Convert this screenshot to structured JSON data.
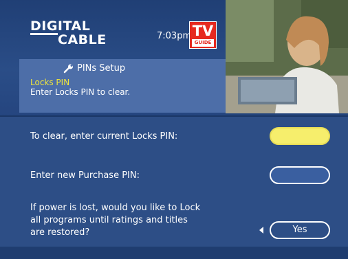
{
  "header": {
    "logo_line1": "DIGITAL",
    "logo_line2": "CABLE",
    "time": "7:03pm",
    "tvguide_tv": "TV",
    "tvguide_guide": "GUIDE"
  },
  "info": {
    "title": "PINs Setup",
    "subtitle_highlight": "Locks PIN",
    "subtitle_instruction": "Enter Locks PIN to clear."
  },
  "form": {
    "clear_label": "To clear, enter current Locks PIN:",
    "new_purchase_label": "Enter new Purchase PIN:",
    "power_lost_line1": "If power is lost, would you like to Lock",
    "power_lost_line2": "all programs until ratings and titles",
    "power_lost_line3": "are restored?",
    "lock_option_value": "Yes"
  },
  "colors": {
    "background": "#2d4e86",
    "highlight": "#f6ee6c",
    "info_box": "#4d6ea8",
    "brand_red": "#e62a1f"
  },
  "icons": [
    "wrench-icon",
    "left-arrow-icon"
  ]
}
